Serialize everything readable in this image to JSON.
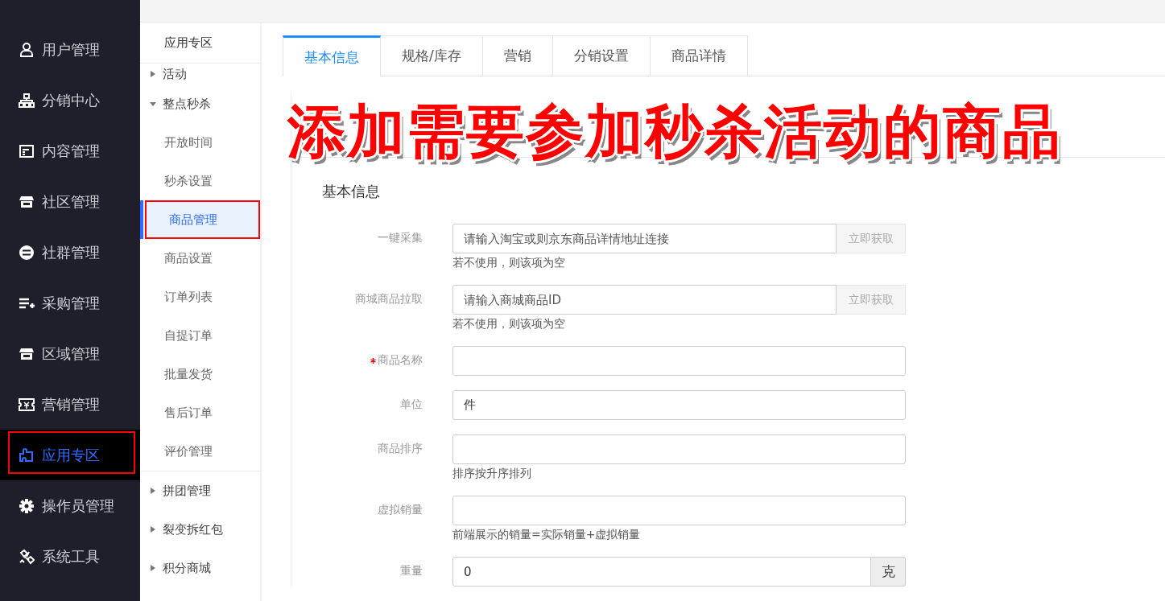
{
  "sidebar": {
    "items": [
      {
        "label": "用户管理",
        "selected": false,
        "highlighted": false
      },
      {
        "label": "分销中心",
        "selected": false,
        "highlighted": false
      },
      {
        "label": "内容管理",
        "selected": false,
        "highlighted": false
      },
      {
        "label": "社区管理",
        "selected": false,
        "highlighted": false
      },
      {
        "label": "社群管理",
        "selected": false,
        "highlighted": false
      },
      {
        "label": "采购管理",
        "selected": false,
        "highlighted": false
      },
      {
        "label": "区域管理",
        "selected": false,
        "highlighted": false
      },
      {
        "label": "营销管理",
        "selected": false,
        "highlighted": false
      },
      {
        "label": "应用专区",
        "selected": true,
        "highlighted": true
      },
      {
        "label": "操作员管理",
        "selected": false,
        "highlighted": false
      },
      {
        "label": "系统工具",
        "selected": false,
        "highlighted": false
      }
    ]
  },
  "submenu": {
    "title": "应用专区",
    "groups": [
      {
        "label": "活动",
        "expanded": false
      },
      {
        "label": "整点秒杀",
        "expanded": true,
        "children": [
          {
            "label": "开放时间",
            "selected": false,
            "highlighted": false
          },
          {
            "label": "秒杀设置",
            "selected": false,
            "highlighted": false
          },
          {
            "label": "商品管理",
            "selected": true,
            "highlighted": true
          },
          {
            "label": "商品设置",
            "selected": false,
            "highlighted": false
          },
          {
            "label": "订单列表",
            "selected": false,
            "highlighted": false
          },
          {
            "label": "自提订单",
            "selected": false,
            "highlighted": false
          },
          {
            "label": "批量发货",
            "selected": false,
            "highlighted": false
          },
          {
            "label": "售后订单",
            "selected": false,
            "highlighted": false
          },
          {
            "label": "评价管理",
            "selected": false,
            "highlighted": false
          }
        ]
      },
      {
        "label": "拼团管理",
        "expanded": false
      },
      {
        "label": "裂变拆红包",
        "expanded": false
      },
      {
        "label": "积分商城",
        "expanded": false
      }
    ]
  },
  "tabs": [
    {
      "label": "基本信息",
      "selected": true
    },
    {
      "label": "规格/库存",
      "selected": false
    },
    {
      "label": "营销",
      "selected": false
    },
    {
      "label": "分销设置",
      "selected": false
    },
    {
      "label": "商品详情",
      "selected": false
    }
  ],
  "callout": "添加需要参加秒杀活动的商品",
  "form": {
    "title": "基本信息",
    "fields": [
      {
        "kind": "fetch",
        "label": "一键采集",
        "required": false,
        "placeholder": "请输入淘宝或则京东商品详情地址连接",
        "button": "立即获取",
        "hint": "若不使用，则该项为空"
      },
      {
        "kind": "fetch",
        "label": "商城商品拉取",
        "required": false,
        "placeholder": "请输入商城商品ID",
        "button": "立即获取",
        "hint": "若不使用，则该项为空"
      },
      {
        "kind": "text",
        "label": "商品名称",
        "required": true
      },
      {
        "kind": "text",
        "label": "单位",
        "required": false,
        "value": "件"
      },
      {
        "kind": "text",
        "label": "商品排序",
        "required": false,
        "hint": "排序按升序排列"
      },
      {
        "kind": "text",
        "label": "虚拟销量",
        "required": false,
        "hint": "前端展示的销量=实际销量+虚拟销量"
      },
      {
        "kind": "addon",
        "label": "重量",
        "required": false,
        "value": "0",
        "addon": "克"
      }
    ]
  }
}
